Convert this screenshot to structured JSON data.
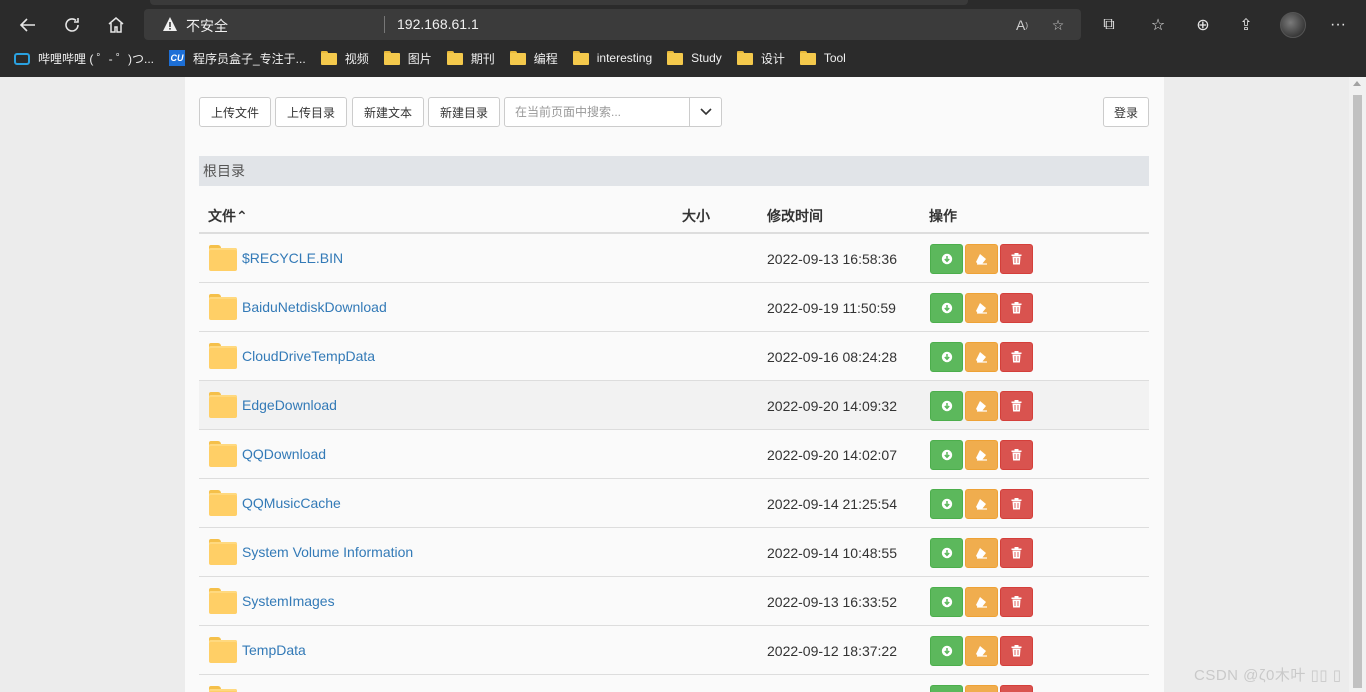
{
  "browser": {
    "security_label": "不安全",
    "url": "192.168.61.1",
    "bookmarks": [
      {
        "label": "哔哩哔哩 ( ゜- ゜)つ...",
        "icon": "bilibili-icon"
      },
      {
        "label": "程序员盒子_专注于...",
        "icon": "cu-icon"
      },
      {
        "label": "视频",
        "icon": "folder-icon"
      },
      {
        "label": "图片",
        "icon": "folder-icon"
      },
      {
        "label": "期刊",
        "icon": "folder-icon"
      },
      {
        "label": "编程",
        "icon": "folder-icon"
      },
      {
        "label": "interesting",
        "icon": "folder-icon"
      },
      {
        "label": "Study",
        "icon": "folder-icon"
      },
      {
        "label": "设计",
        "icon": "folder-icon"
      },
      {
        "label": "Tool",
        "icon": "folder-icon"
      }
    ]
  },
  "toolbar": {
    "upload_file": "上传文件",
    "upload_dir": "上传目录",
    "new_text": "新建文本",
    "new_dir": "新建目录",
    "search_placeholder": "在当前页面中搜索...",
    "login": "登录"
  },
  "breadcrumb": "根目录",
  "table": {
    "headers": {
      "file": "文件",
      "size": "大小",
      "modified": "修改时间",
      "actions": "操作"
    },
    "rows": [
      {
        "name": "$RECYCLE.BIN",
        "size": "",
        "modified": "2022-09-13 16:58:36"
      },
      {
        "name": "BaiduNetdiskDownload",
        "size": "",
        "modified": "2022-09-19 11:50:59"
      },
      {
        "name": "CloudDriveTempData",
        "size": "",
        "modified": "2022-09-16 08:24:28"
      },
      {
        "name": "EdgeDownload",
        "size": "",
        "modified": "2022-09-20 14:09:32"
      },
      {
        "name": "QQDownload",
        "size": "",
        "modified": "2022-09-20 14:02:07"
      },
      {
        "name": "QQMusicCache",
        "size": "",
        "modified": "2022-09-14 21:25:54"
      },
      {
        "name": "System Volume Information",
        "size": "",
        "modified": "2022-09-14 10:48:55"
      },
      {
        "name": "SystemImages",
        "size": "",
        "modified": "2022-09-13 16:33:52"
      },
      {
        "name": "TempData",
        "size": "",
        "modified": "2022-09-12 18:37:22"
      },
      {
        "name": "",
        "size": "",
        "modified": ""
      }
    ]
  },
  "watermark": "CSDN @ζ0木叶 ▯▯ ▯",
  "colors": {
    "link": "#337ab7",
    "download": "#5cb85c",
    "edit": "#f0ad4e",
    "delete": "#d9534f",
    "folder": "#ffcf66"
  }
}
